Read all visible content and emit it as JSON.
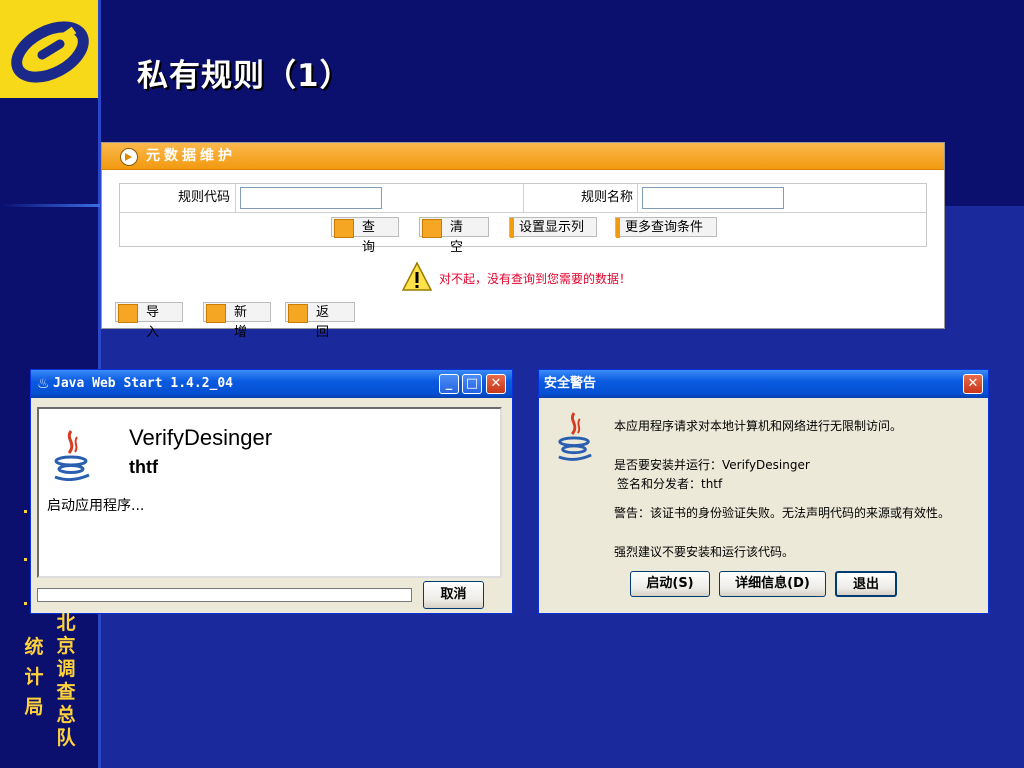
{
  "slide": {
    "title": "私有规则（1）",
    "side_text": [
      "北京调查总队",
      "统 计 局"
    ],
    "colors": {
      "background": "#0b0f6e",
      "band": "#1a2a9c",
      "logo": "#f7d91a",
      "side_text": "#ffd23a"
    }
  },
  "webapp": {
    "header": "元数据维护",
    "fields": [
      {
        "label": "规则代码",
        "value": ""
      },
      {
        "label": "规则名称",
        "value": ""
      }
    ],
    "buttons": {
      "query": "查 询",
      "clear": "清 空",
      "display_cols": "设置显示列",
      "more": "更多查询条件"
    },
    "message": "对不起，没有查询到您需要的数据！",
    "actions": {
      "import": "导 入",
      "add": "新 增",
      "back": "返 回"
    }
  },
  "jws_window": {
    "title": "Java Web Start 1.4.2_04",
    "app_name": "VerifyDesinger",
    "vendor": "thtf",
    "status": "启动应用程序...",
    "progress": 0,
    "cancel": "取消"
  },
  "security_dialog": {
    "title": "安全警告",
    "line1": "本应用程序请求对本地计算机和网络进行无限制访问。",
    "line2": "是否要安装并运行：VerifyDesinger",
    "line3": "签名和分发者：thtf",
    "line4": "警告：该证书的身份验证失败。无法声明代码的来源或有效性。",
    "line5": "强烈建议不要安装和运行该代码。",
    "buttons": {
      "start": "启动(S)",
      "details": "详细信息(D)",
      "exit": "退出"
    }
  }
}
